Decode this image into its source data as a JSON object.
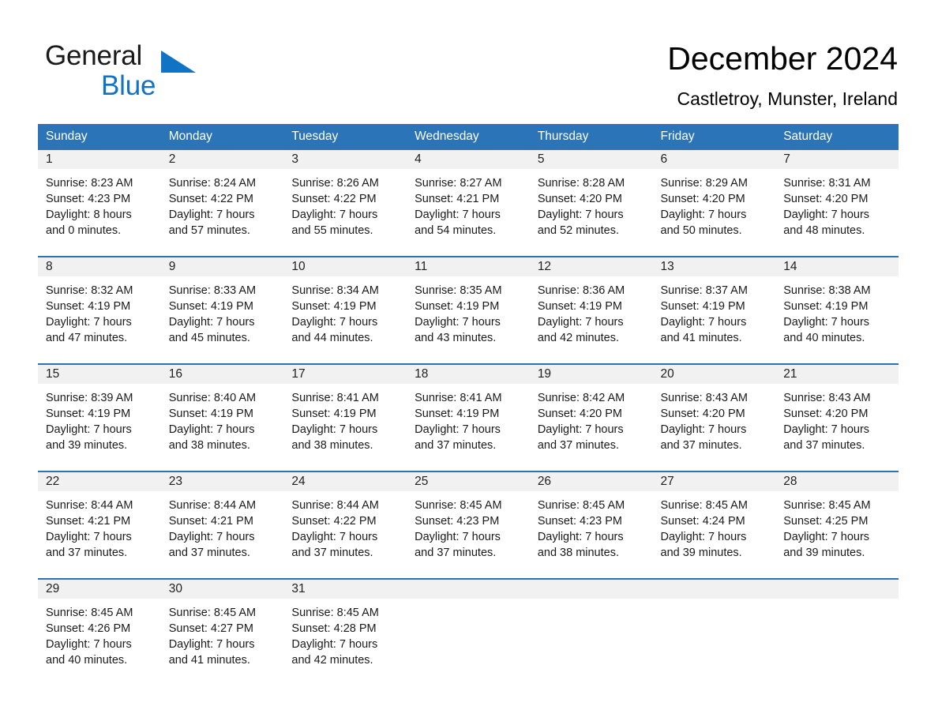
{
  "brand": {
    "line1": "General",
    "line2": "Blue",
    "triangle_color": "#1173c4"
  },
  "header": {
    "month_title": "December 2024",
    "location": "Castletroy, Munster, Ireland"
  },
  "colors": {
    "header_blue": "#2b74b8",
    "daynum_band": "#f1f1f1",
    "text": "#1a1a1a"
  },
  "weekday_headers": [
    "Sunday",
    "Monday",
    "Tuesday",
    "Wednesday",
    "Thursday",
    "Friday",
    "Saturday"
  ],
  "weeks": [
    [
      {
        "day": "1",
        "sunrise": "Sunrise: 8:23 AM",
        "sunset": "Sunset: 4:23 PM",
        "daylight": "Daylight: 8 hours and 0 minutes."
      },
      {
        "day": "2",
        "sunrise": "Sunrise: 8:24 AM",
        "sunset": "Sunset: 4:22 PM",
        "daylight": "Daylight: 7 hours and 57 minutes."
      },
      {
        "day": "3",
        "sunrise": "Sunrise: 8:26 AM",
        "sunset": "Sunset: 4:22 PM",
        "daylight": "Daylight: 7 hours and 55 minutes."
      },
      {
        "day": "4",
        "sunrise": "Sunrise: 8:27 AM",
        "sunset": "Sunset: 4:21 PM",
        "daylight": "Daylight: 7 hours and 54 minutes."
      },
      {
        "day": "5",
        "sunrise": "Sunrise: 8:28 AM",
        "sunset": "Sunset: 4:20 PM",
        "daylight": "Daylight: 7 hours and 52 minutes."
      },
      {
        "day": "6",
        "sunrise": "Sunrise: 8:29 AM",
        "sunset": "Sunset: 4:20 PM",
        "daylight": "Daylight: 7 hours and 50 minutes."
      },
      {
        "day": "7",
        "sunrise": "Sunrise: 8:31 AM",
        "sunset": "Sunset: 4:20 PM",
        "daylight": "Daylight: 7 hours and 48 minutes."
      }
    ],
    [
      {
        "day": "8",
        "sunrise": "Sunrise: 8:32 AM",
        "sunset": "Sunset: 4:19 PM",
        "daylight": "Daylight: 7 hours and 47 minutes."
      },
      {
        "day": "9",
        "sunrise": "Sunrise: 8:33 AM",
        "sunset": "Sunset: 4:19 PM",
        "daylight": "Daylight: 7 hours and 45 minutes."
      },
      {
        "day": "10",
        "sunrise": "Sunrise: 8:34 AM",
        "sunset": "Sunset: 4:19 PM",
        "daylight": "Daylight: 7 hours and 44 minutes."
      },
      {
        "day": "11",
        "sunrise": "Sunrise: 8:35 AM",
        "sunset": "Sunset: 4:19 PM",
        "daylight": "Daylight: 7 hours and 43 minutes."
      },
      {
        "day": "12",
        "sunrise": "Sunrise: 8:36 AM",
        "sunset": "Sunset: 4:19 PM",
        "daylight": "Daylight: 7 hours and 42 minutes."
      },
      {
        "day": "13",
        "sunrise": "Sunrise: 8:37 AM",
        "sunset": "Sunset: 4:19 PM",
        "daylight": "Daylight: 7 hours and 41 minutes."
      },
      {
        "day": "14",
        "sunrise": "Sunrise: 8:38 AM",
        "sunset": "Sunset: 4:19 PM",
        "daylight": "Daylight: 7 hours and 40 minutes."
      }
    ],
    [
      {
        "day": "15",
        "sunrise": "Sunrise: 8:39 AM",
        "sunset": "Sunset: 4:19 PM",
        "daylight": "Daylight: 7 hours and 39 minutes."
      },
      {
        "day": "16",
        "sunrise": "Sunrise: 8:40 AM",
        "sunset": "Sunset: 4:19 PM",
        "daylight": "Daylight: 7 hours and 38 minutes."
      },
      {
        "day": "17",
        "sunrise": "Sunrise: 8:41 AM",
        "sunset": "Sunset: 4:19 PM",
        "daylight": "Daylight: 7 hours and 38 minutes."
      },
      {
        "day": "18",
        "sunrise": "Sunrise: 8:41 AM",
        "sunset": "Sunset: 4:19 PM",
        "daylight": "Daylight: 7 hours and 37 minutes."
      },
      {
        "day": "19",
        "sunrise": "Sunrise: 8:42 AM",
        "sunset": "Sunset: 4:20 PM",
        "daylight": "Daylight: 7 hours and 37 minutes."
      },
      {
        "day": "20",
        "sunrise": "Sunrise: 8:43 AM",
        "sunset": "Sunset: 4:20 PM",
        "daylight": "Daylight: 7 hours and 37 minutes."
      },
      {
        "day": "21",
        "sunrise": "Sunrise: 8:43 AM",
        "sunset": "Sunset: 4:20 PM",
        "daylight": "Daylight: 7 hours and 37 minutes."
      }
    ],
    [
      {
        "day": "22",
        "sunrise": "Sunrise: 8:44 AM",
        "sunset": "Sunset: 4:21 PM",
        "daylight": "Daylight: 7 hours and 37 minutes."
      },
      {
        "day": "23",
        "sunrise": "Sunrise: 8:44 AM",
        "sunset": "Sunset: 4:21 PM",
        "daylight": "Daylight: 7 hours and 37 minutes."
      },
      {
        "day": "24",
        "sunrise": "Sunrise: 8:44 AM",
        "sunset": "Sunset: 4:22 PM",
        "daylight": "Daylight: 7 hours and 37 minutes."
      },
      {
        "day": "25",
        "sunrise": "Sunrise: 8:45 AM",
        "sunset": "Sunset: 4:23 PM",
        "daylight": "Daylight: 7 hours and 37 minutes."
      },
      {
        "day": "26",
        "sunrise": "Sunrise: 8:45 AM",
        "sunset": "Sunset: 4:23 PM",
        "daylight": "Daylight: 7 hours and 38 minutes."
      },
      {
        "day": "27",
        "sunrise": "Sunrise: 8:45 AM",
        "sunset": "Sunset: 4:24 PM",
        "daylight": "Daylight: 7 hours and 39 minutes."
      },
      {
        "day": "28",
        "sunrise": "Sunrise: 8:45 AM",
        "sunset": "Sunset: 4:25 PM",
        "daylight": "Daylight: 7 hours and 39 minutes."
      }
    ],
    [
      {
        "day": "29",
        "sunrise": "Sunrise: 8:45 AM",
        "sunset": "Sunset: 4:26 PM",
        "daylight": "Daylight: 7 hours and 40 minutes."
      },
      {
        "day": "30",
        "sunrise": "Sunrise: 8:45 AM",
        "sunset": "Sunset: 4:27 PM",
        "daylight": "Daylight: 7 hours and 41 minutes."
      },
      {
        "day": "31",
        "sunrise": "Sunrise: 8:45 AM",
        "sunset": "Sunset: 4:28 PM",
        "daylight": "Daylight: 7 hours and 42 minutes."
      },
      {
        "day": "",
        "sunrise": "",
        "sunset": "",
        "daylight": ""
      },
      {
        "day": "",
        "sunrise": "",
        "sunset": "",
        "daylight": ""
      },
      {
        "day": "",
        "sunrise": "",
        "sunset": "",
        "daylight": ""
      },
      {
        "day": "",
        "sunrise": "",
        "sunset": "",
        "daylight": ""
      }
    ]
  ]
}
